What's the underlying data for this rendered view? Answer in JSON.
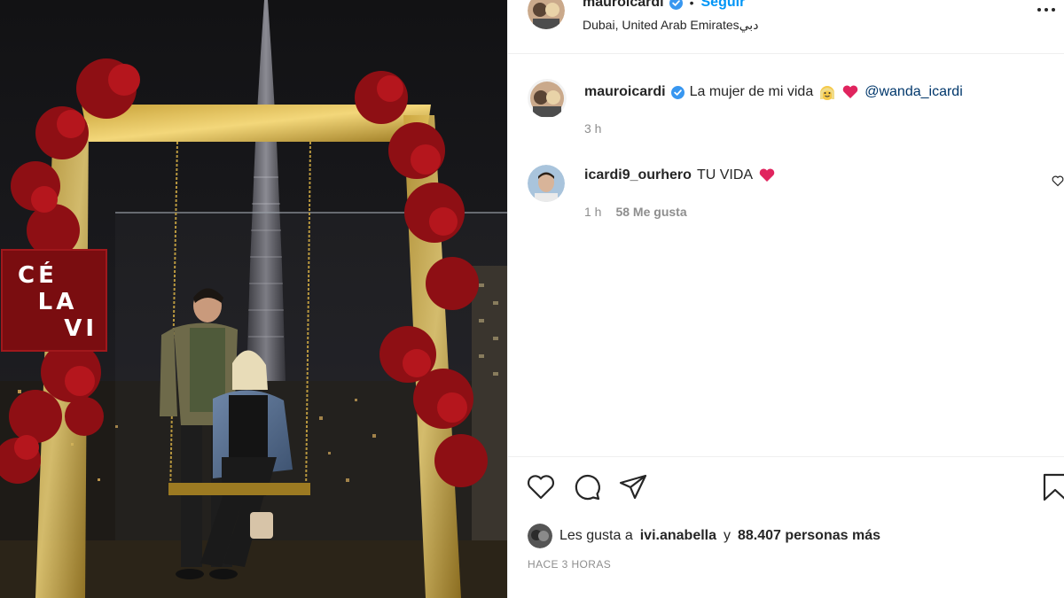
{
  "header": {
    "username": "mauroicardi",
    "separator": "•",
    "follow_label": "Seguir",
    "location": "Dubai, United Arab Emiratesدبي"
  },
  "caption": {
    "username": "mauroicardi",
    "text": "La mujer de mi vida",
    "mention": "@wanda_icardi",
    "time": "3 h"
  },
  "comment": {
    "username": "icardi9_ourhero",
    "text": "TU VIDA",
    "time": "1 h",
    "likes": "58 Me gusta"
  },
  "likes_summary": {
    "prefix": "Les gusta a",
    "user": "ivi.anabella",
    "connector": "y",
    "others": "88.407 personas más"
  },
  "post_age": "HACE 3 HORAS",
  "photo": {
    "sign_line1": "CÉ",
    "sign_line2": "LA",
    "sign_line3": "VI"
  },
  "colors": {
    "link_blue": "#0095f6",
    "mention_blue": "#00376b",
    "verified_blue": "#3897f0",
    "heart_red": "#e0245e",
    "muted_gray": "#8e8e8e"
  },
  "icons": {
    "more": "more-options-icon",
    "like": "heart-outline-icon",
    "comment": "speech-bubble-icon",
    "share": "paper-plane-icon",
    "save": "bookmark-icon"
  }
}
